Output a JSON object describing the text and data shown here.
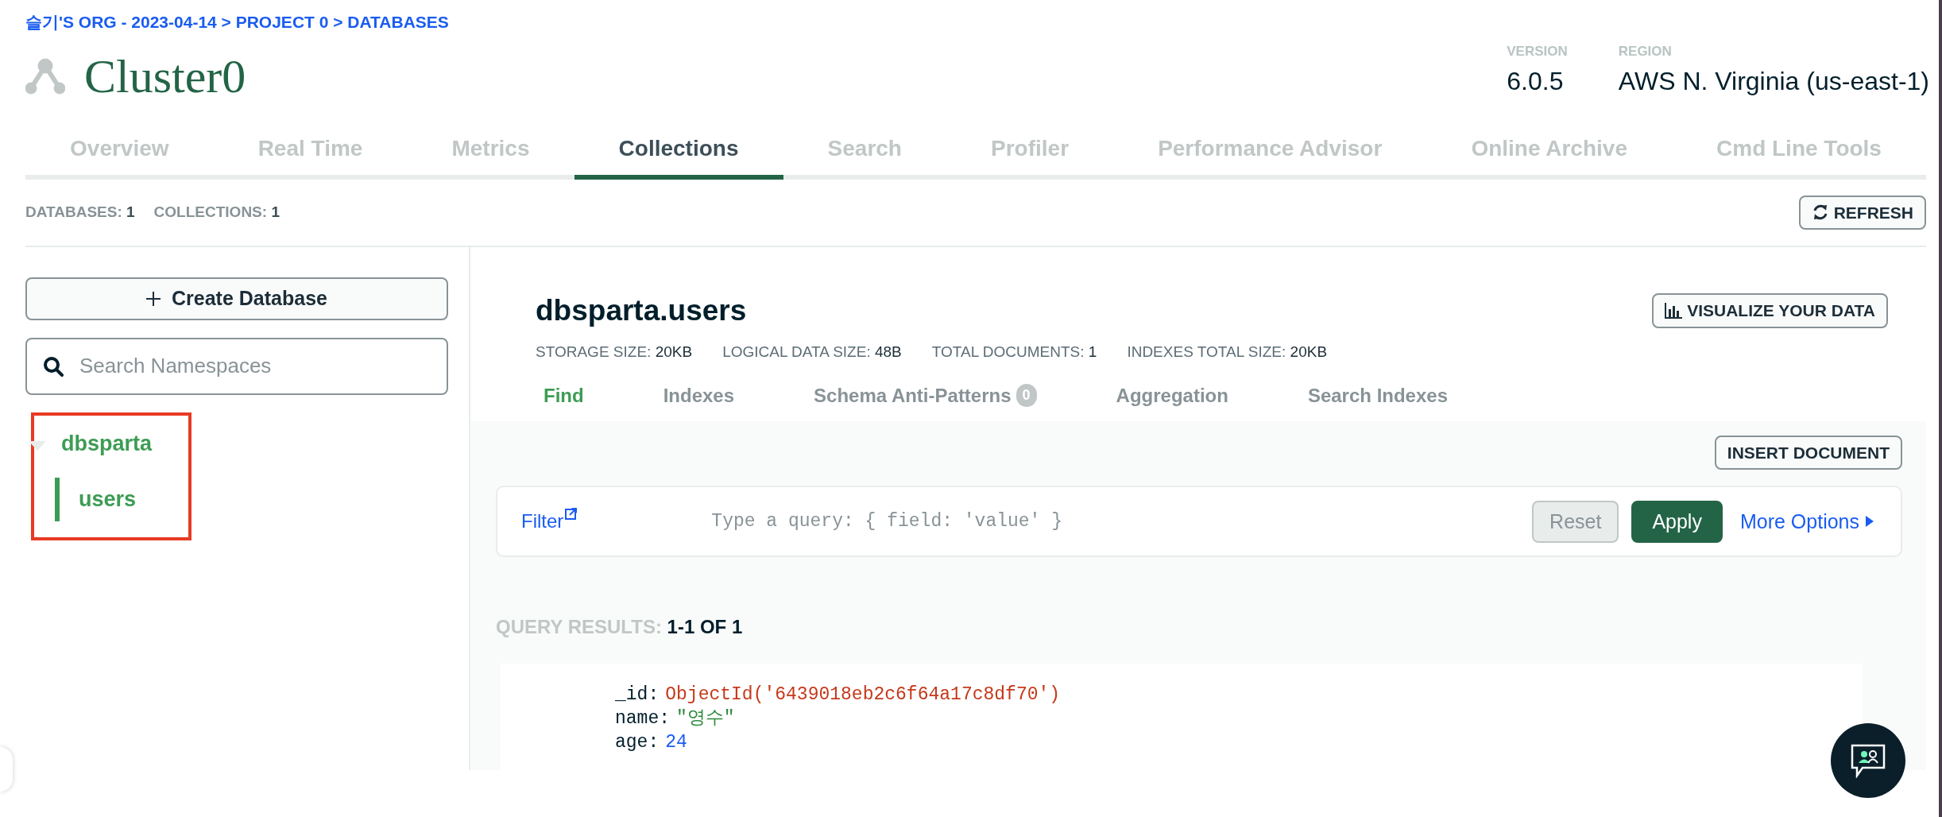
{
  "breadcrumb": "슬기'S ORG - 2023-04-14 > PROJECT 0 > DATABASES",
  "cluster": {
    "name": "Cluster0"
  },
  "info": [
    {
      "label": "VERSION",
      "value": "6.0.5"
    },
    {
      "label": "REGION",
      "value": "AWS N. Virginia (us-east-1)"
    }
  ],
  "tabs": [
    {
      "label": "Overview",
      "selected": false
    },
    {
      "label": "Real Time",
      "selected": false
    },
    {
      "label": "Metrics",
      "selected": false
    },
    {
      "label": "Collections",
      "selected": true
    },
    {
      "label": "Search",
      "selected": false
    },
    {
      "label": "Profiler",
      "selected": false
    },
    {
      "label": "Performance Advisor",
      "selected": false
    },
    {
      "label": "Online Archive",
      "selected": false
    },
    {
      "label": "Cmd Line Tools",
      "selected": false
    }
  ],
  "counts": [
    {
      "label": "DATABASES:",
      "value": "1"
    },
    {
      "label": "COLLECTIONS:",
      "value": "1"
    }
  ],
  "refresh_button": "REFRESH",
  "sidebar": {
    "create_button": "Create Database",
    "search": {
      "placeholder": "Search Namespaces"
    },
    "tree": [
      {
        "label": "dbsparta",
        "expanded": true,
        "selected": false,
        "children": [
          {
            "label": "users",
            "selected": true
          }
        ]
      }
    ]
  },
  "collection": {
    "title": "dbsparta.users",
    "visualize_button": "VISUALIZE YOUR DATA",
    "stats": [
      {
        "label": "STORAGE SIZE:",
        "value": "20KB"
      },
      {
        "label": "LOGICAL DATA SIZE:",
        "value": "48B"
      },
      {
        "label": "TOTAL DOCUMENTS:",
        "value": "1"
      },
      {
        "label": "INDEXES TOTAL SIZE:",
        "value": "20KB"
      }
    ],
    "subtabs": [
      {
        "label": "Find",
        "selected": true
      },
      {
        "label": "Indexes",
        "selected": false
      },
      {
        "label": "Schema Anti-Patterns",
        "selected": false,
        "badge": "0"
      },
      {
        "label": "Aggregation",
        "selected": false
      },
      {
        "label": "Search Indexes",
        "selected": false
      }
    ],
    "insert_button": "INSERT DOCUMENT",
    "filter": {
      "label": "Filter",
      "placeholder": "Type a query: { field: 'value' }",
      "reset_button": "Reset",
      "apply_button": "Apply",
      "more_options": "More Options"
    },
    "results_label": "QUERY RESULTS:",
    "results_count": "1-1 OF 1",
    "document": [
      {
        "key": "_id:",
        "value": "ObjectId('6439018eb2c6f64a17c8df70')",
        "kind": "objectid"
      },
      {
        "key": "name:",
        "value": "\"영수\"",
        "kind": "string"
      },
      {
        "key": "age:",
        "value": "24",
        "kind": "number"
      }
    ]
  }
}
